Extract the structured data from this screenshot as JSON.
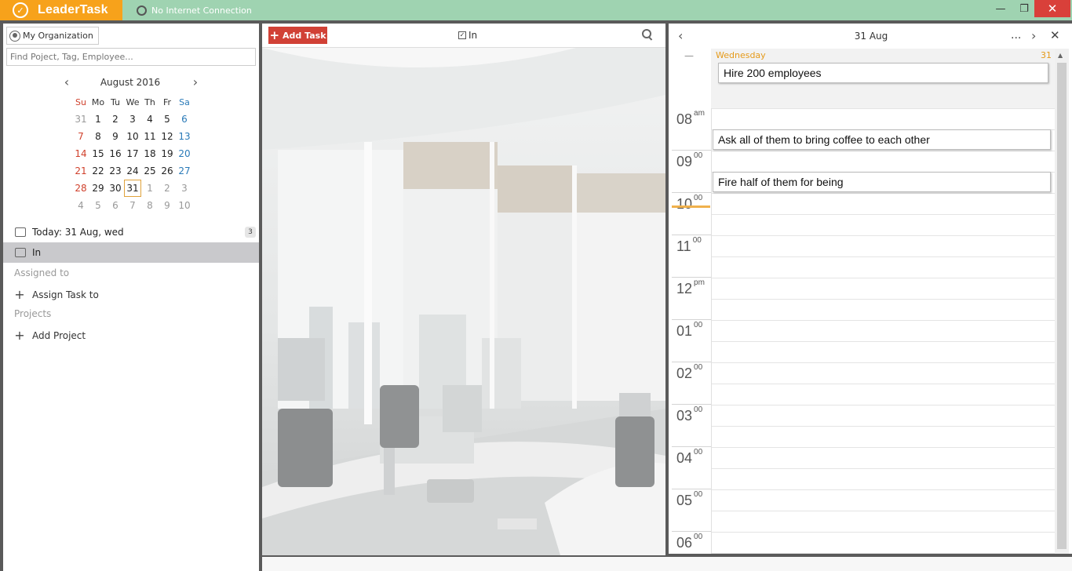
{
  "app": {
    "name": "LeaderTask",
    "connection_status": "No Internet Connection",
    "window_controls": {
      "minimize": "—",
      "maximize": "❐",
      "close": "✕"
    }
  },
  "sidebar": {
    "organization_label": "My Organization",
    "search_placeholder": "Find Poject, Tag, Employee...",
    "calendar": {
      "title": "August 2016",
      "prev": "‹",
      "next": "›",
      "weekdays": [
        "Su",
        "Mo",
        "Tu",
        "We",
        "Th",
        "Fr",
        "Sa"
      ],
      "weeks": [
        [
          "31",
          "1",
          "2",
          "3",
          "4",
          "5",
          "6"
        ],
        [
          "7",
          "8",
          "9",
          "10",
          "11",
          "12",
          "13"
        ],
        [
          "14",
          "15",
          "16",
          "17",
          "18",
          "19",
          "20"
        ],
        [
          "21",
          "22",
          "23",
          "24",
          "25",
          "26",
          "27"
        ],
        [
          "28",
          "29",
          "30",
          "31",
          "1",
          "2",
          "3"
        ],
        [
          "4",
          "5",
          "6",
          "7",
          "8",
          "9",
          "10"
        ]
      ],
      "selected_day": "31"
    },
    "today_label": "Today: 31 Aug, wed",
    "today_count": "3",
    "in_label": "In",
    "assigned_section": "Assigned to",
    "assign_task_label": "Assign Task to",
    "projects_section": "Projects",
    "add_project_label": "Add Project"
  },
  "middle": {
    "add_task_label": "Add Task",
    "filter_label": "In"
  },
  "day_view": {
    "title": "31 Aug",
    "weekday": "Wednesday",
    "day_number": "31",
    "more_label": "...",
    "allday_dash": "—",
    "allday_task": "Hire 200 employees",
    "tasks": [
      "Ask all of them to bring coffee to each other",
      "Fire half of them for being"
    ],
    "hours": [
      {
        "hour": "08",
        "suffix": "am"
      },
      {
        "hour": "09",
        "suffix": "00"
      },
      {
        "hour": "10",
        "suffix": "00"
      },
      {
        "hour": "11",
        "suffix": "00"
      },
      {
        "hour": "12",
        "suffix": "pm"
      },
      {
        "hour": "01",
        "suffix": "00"
      },
      {
        "hour": "02",
        "suffix": "00"
      },
      {
        "hour": "03",
        "suffix": "00"
      },
      {
        "hour": "04",
        "suffix": "00"
      },
      {
        "hour": "05",
        "suffix": "00"
      },
      {
        "hour": "06",
        "suffix": "00"
      }
    ]
  }
}
